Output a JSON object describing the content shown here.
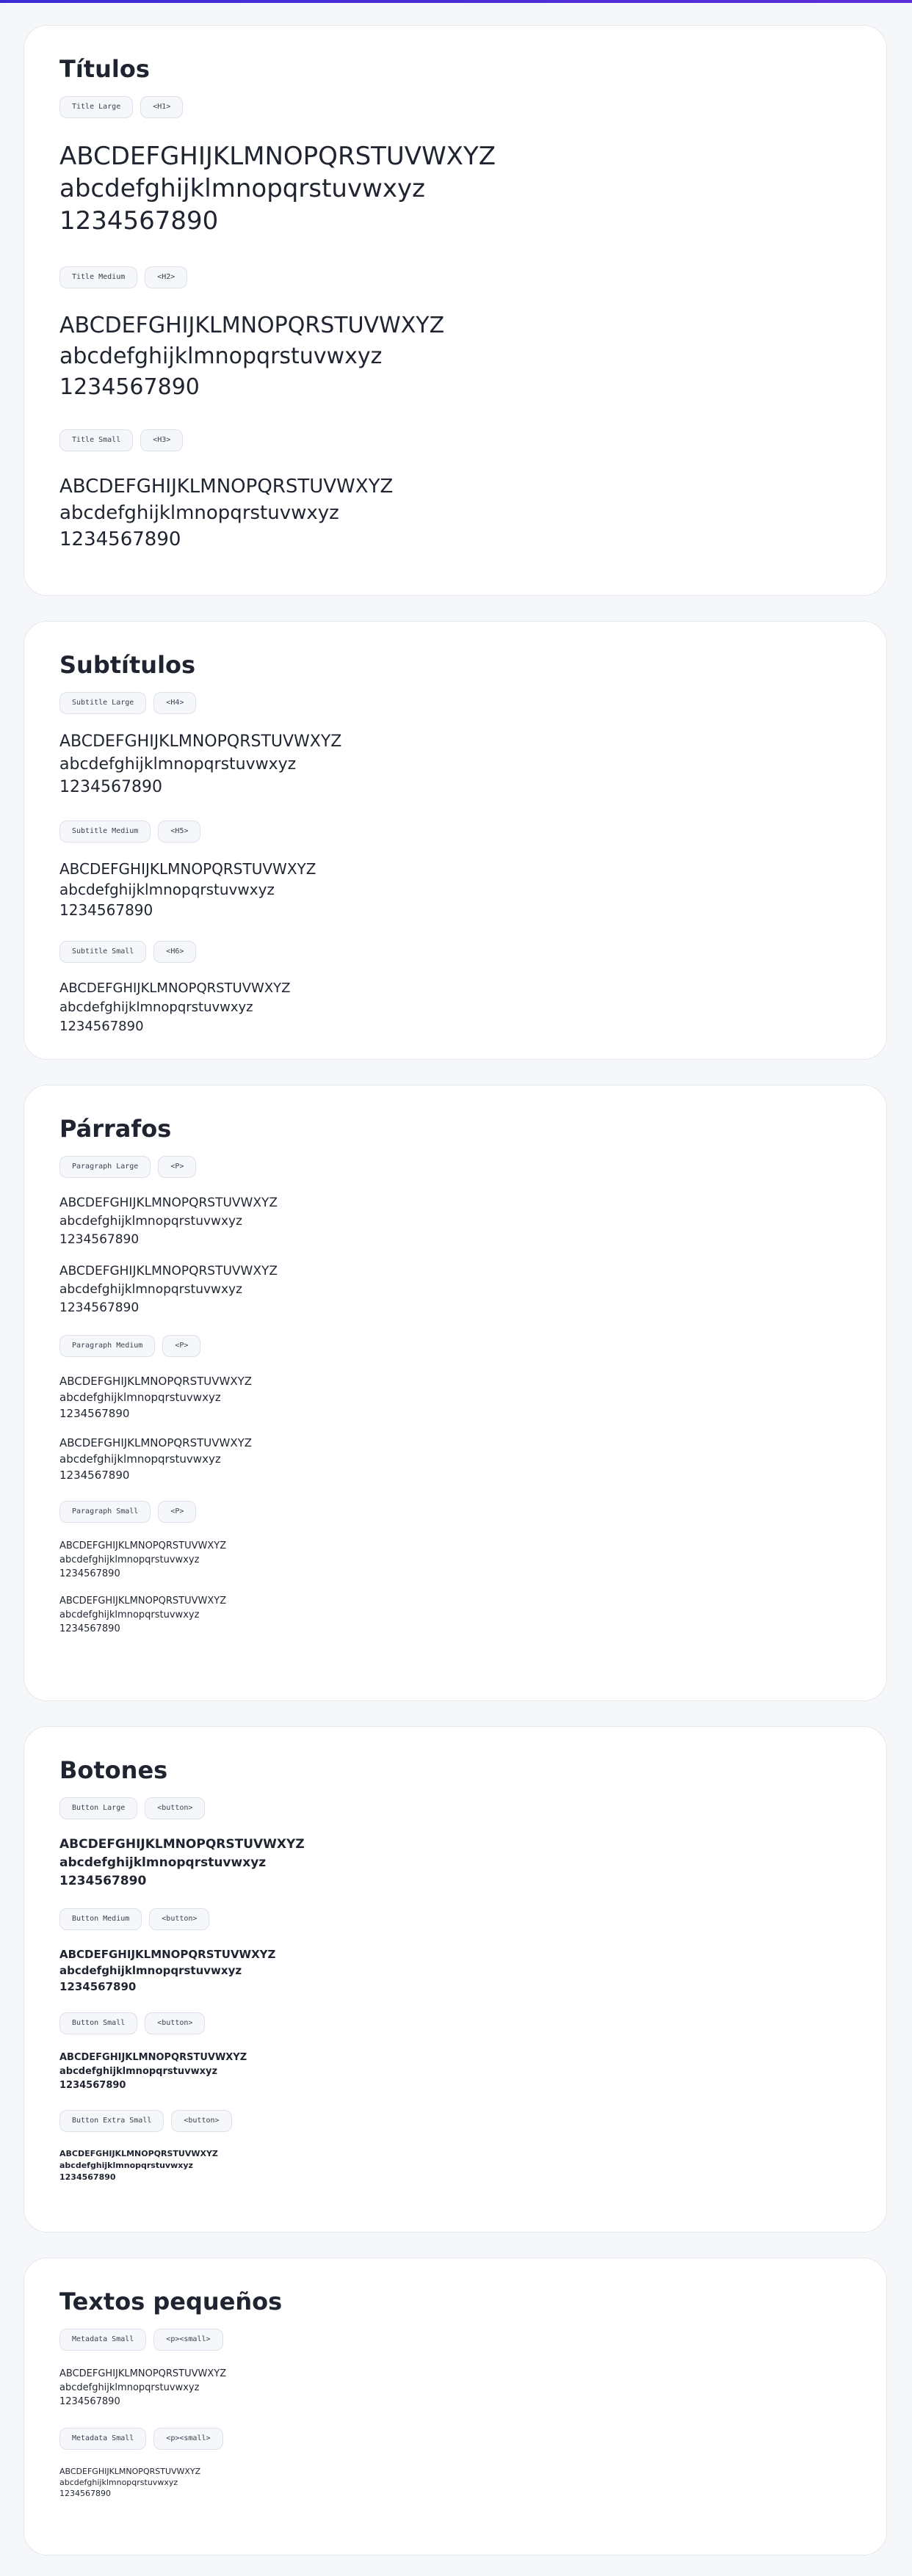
{
  "sample": {
    "upper": "ABCDEFGHIJKLMNOPQRSTUVWXYZ",
    "lower": "abcdefghijklmnopqrstuvwxyz",
    "digits": "1234567890"
  },
  "titulos": {
    "heading": "Títulos",
    "groups": [
      {
        "name": "Title Large",
        "tag": "<H1>"
      },
      {
        "name": "Title Medium",
        "tag": "<H2>"
      },
      {
        "name": "Title Small",
        "tag": "<H3>"
      }
    ]
  },
  "subtitulos": {
    "heading": "Subtítulos",
    "groups": [
      {
        "name": "Subtitle Large",
        "tag": "<H4>"
      },
      {
        "name": "Subtitle Medium",
        "tag": "<H5>"
      },
      {
        "name": "Subtitle Small",
        "tag": "<H6>"
      }
    ]
  },
  "parrafos": {
    "heading": "Párrafos",
    "groups": [
      {
        "name": "Paragraph Large",
        "tag": "<P>"
      },
      {
        "name": "Paragraph Medium",
        "tag": "<P>"
      },
      {
        "name": "Paragraph Small",
        "tag": "<P>"
      }
    ]
  },
  "botones": {
    "heading": "Botones",
    "groups": [
      {
        "name": "Button Large",
        "tag": "<button>"
      },
      {
        "name": "Button Medium",
        "tag": "<button>"
      },
      {
        "name": "Button Small",
        "tag": "<button>"
      },
      {
        "name": "Button Extra Small",
        "tag": "<button>"
      }
    ]
  },
  "textos": {
    "heading": "Textos pequeños",
    "groups": [
      {
        "name": "Metadata Small",
        "tag": "<p><small>"
      },
      {
        "name": "Metadata Small",
        "tag": "<p><small>"
      }
    ]
  },
  "colors": {
    "accent": "#3b2bd6",
    "text": "#1f2430",
    "card_border": "#e5e8ee",
    "tag_bg": "#f5f7fb"
  }
}
